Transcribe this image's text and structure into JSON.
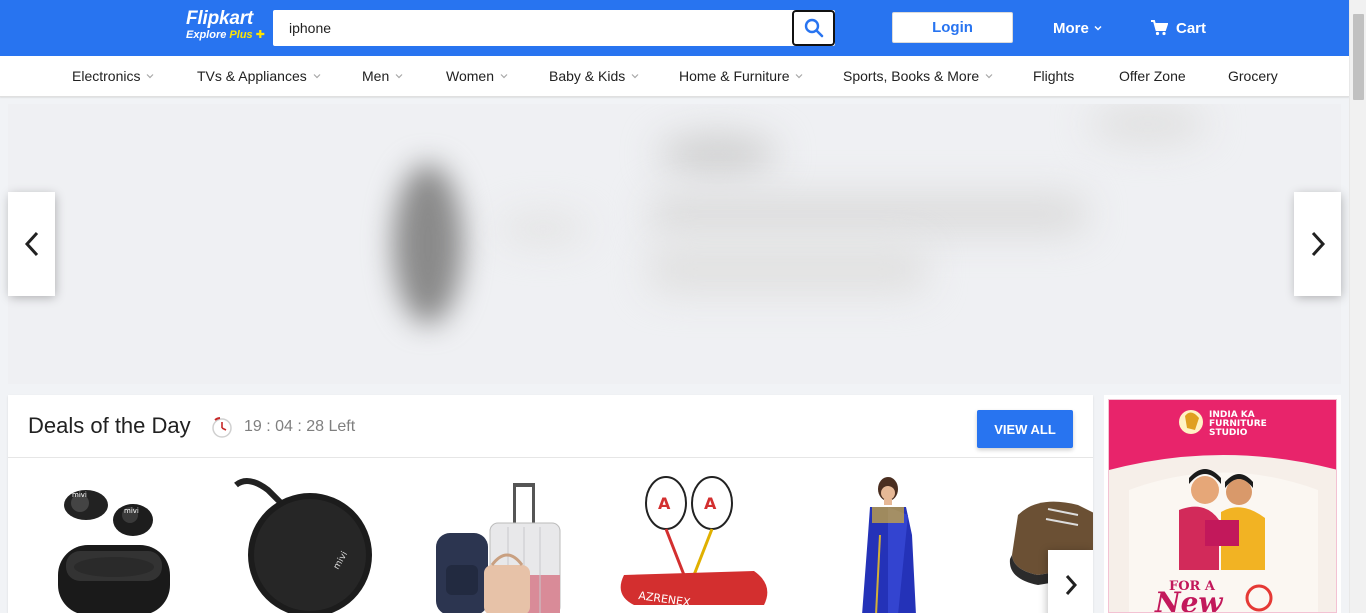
{
  "header": {
    "logo_text": "Flipkart",
    "logo_sub_explore": "Explore",
    "logo_sub_plus": "Plus",
    "search_value": "iphone",
    "login_label": "Login",
    "more_label": "More",
    "cart_label": "Cart",
    "accent_color": "#2874f0"
  },
  "categories": [
    {
      "label": "Electronics",
      "has_dropdown": true
    },
    {
      "label": "TVs & Appliances",
      "has_dropdown": true
    },
    {
      "label": "Men",
      "has_dropdown": true
    },
    {
      "label": "Women",
      "has_dropdown": true
    },
    {
      "label": "Baby & Kids",
      "has_dropdown": true
    },
    {
      "label": "Home & Furniture",
      "has_dropdown": true
    },
    {
      "label": "Sports, Books & More",
      "has_dropdown": true
    },
    {
      "label": "Flights",
      "has_dropdown": false
    },
    {
      "label": "Offer Zone",
      "has_dropdown": false
    },
    {
      "label": "Grocery",
      "has_dropdown": false
    }
  ],
  "deals": {
    "title": "Deals of the Day",
    "timer": "19 : 04 : 28 Left",
    "view_all_label": "VIEW ALL",
    "items": [
      {
        "icon": "earbuds-image"
      },
      {
        "icon": "speaker-image"
      },
      {
        "icon": "luggage-image"
      },
      {
        "icon": "badminton-racket-image"
      },
      {
        "icon": "saree-image"
      },
      {
        "icon": "shoe-image"
      }
    ]
  },
  "ad": {
    "top_text_line1": "INDIA KA",
    "top_text_line2": "FURNITURE",
    "top_text_line3": "STUDIO",
    "bottom_text_small": "FOR A",
    "bottom_text_big": "New"
  }
}
